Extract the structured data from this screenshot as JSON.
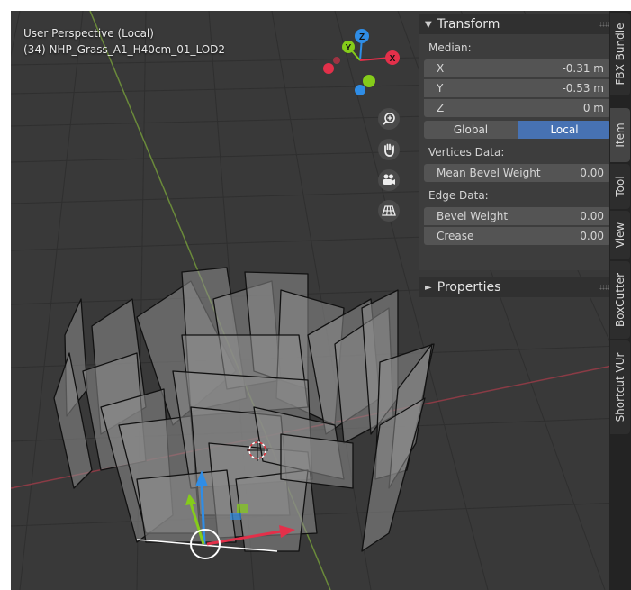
{
  "viewport": {
    "title": "User Perspective (Local)",
    "object_name": "(34) NHP_Grass_A1_H40cm_01_LOD2",
    "background_color": "#393939",
    "gizmo_axes": {
      "z": "Z",
      "y": "Y",
      "x": "X"
    },
    "axis_colors": {
      "x": "#e3304a",
      "y": "#85cc1a",
      "z": "#2f8de6"
    },
    "nav_icons": [
      "zoom-icon",
      "hand-pan-icon",
      "camera-icon",
      "grid-ortho-icon"
    ]
  },
  "n_panel": {
    "transform": {
      "title": "Transform",
      "median_label": "Median:",
      "coords": [
        {
          "axis": "X",
          "value": "-0.31 m"
        },
        {
          "axis": "Y",
          "value": "-0.53 m"
        },
        {
          "axis": "Z",
          "value": "0 m"
        }
      ],
      "space": {
        "options": [
          "Global",
          "Local"
        ],
        "selected": "Local"
      },
      "vertices_section": "Vertices Data:",
      "mean_bevel_label": "Mean Bevel Weight",
      "mean_bevel_value": "0.00",
      "edge_section": "Edge Data:",
      "bevel_weight_label": "Bevel Weight",
      "bevel_weight_value": "0.00",
      "crease_label": "Crease",
      "crease_value": "0.00"
    },
    "properties": {
      "title": "Properties"
    }
  },
  "tabs": [
    "FBX Bundle",
    "Item",
    "Tool",
    "View",
    "BoxCutter",
    "Shortcut VUr"
  ],
  "active_tab": "Item"
}
